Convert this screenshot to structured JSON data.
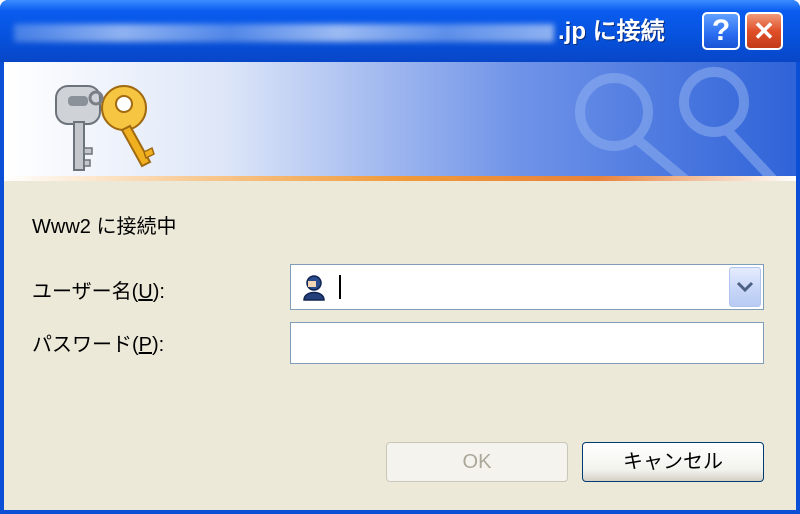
{
  "window": {
    "title_suffix": ".jp に接続",
    "help_label": "?",
    "close_label": "✕"
  },
  "dialog": {
    "message": "Www2 に接続中",
    "username_label_pre": "ユーザー名(",
    "username_accel": "U",
    "username_label_post": "):",
    "password_label_pre": "パスワード(",
    "password_accel": "P",
    "password_label_post": "):",
    "username_value": "",
    "password_value": ""
  },
  "buttons": {
    "ok_label": "OK",
    "cancel_label": "キャンセル"
  },
  "icons": {
    "banner": "keys-icon",
    "user": "user-icon",
    "dropdown": "chevron-down-icon"
  },
  "colors": {
    "titlebar": "#0652dc",
    "client": "#ece9d8",
    "accent_line": "#f09a3a",
    "close": "#e0502a"
  }
}
